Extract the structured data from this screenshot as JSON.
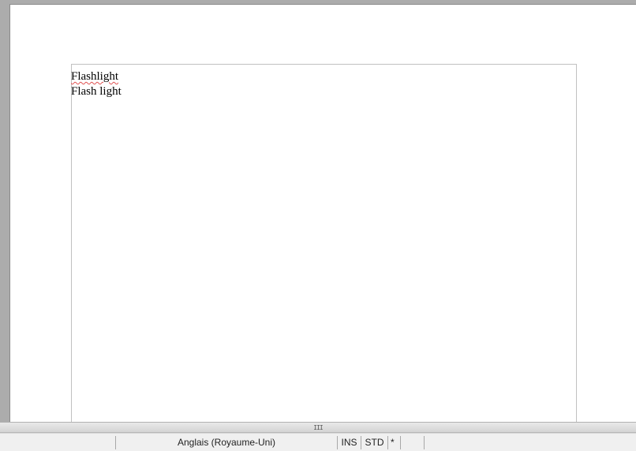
{
  "document": {
    "lines": [
      {
        "text": "Flashlight",
        "misspelled": true
      },
      {
        "text": "Flash light",
        "misspelled": false
      }
    ]
  },
  "scrollbar": {
    "grip": "III"
  },
  "statusbar": {
    "language": "Anglais (Royaume-Uni)",
    "insert_mode": "INS",
    "selection_mode": "STD",
    "modified": "*"
  },
  "colors": {
    "page": "#ffffff",
    "workspace": "#acacac",
    "spellcheck_underline": "#e05050"
  }
}
